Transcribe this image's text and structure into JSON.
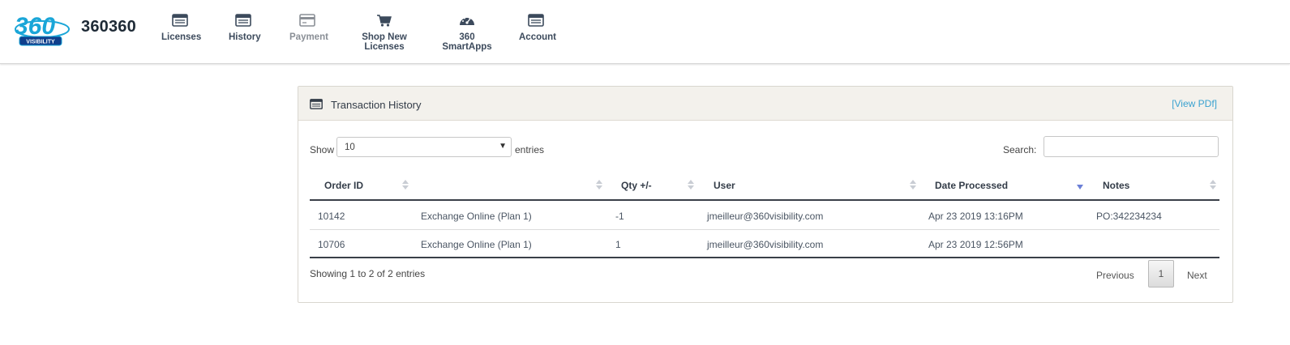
{
  "brand": {
    "logo_text": "360",
    "logo_sub": "VISIBILITY",
    "company": "360360"
  },
  "nav": [
    {
      "label": "Licenses",
      "icon": "licenses-icon",
      "enabled": true
    },
    {
      "label": "History",
      "icon": "history-icon",
      "enabled": true
    },
    {
      "label": "Payment",
      "icon": "credit-card-icon",
      "enabled": false
    },
    {
      "label": "Shop New Licenses",
      "icon": "shopping-cart-icon",
      "enabled": true
    },
    {
      "label": "360 SmartApps",
      "icon": "dashboard-gauge-icon",
      "enabled": true
    },
    {
      "label": "Account",
      "icon": "account-icon",
      "enabled": true
    }
  ],
  "panel": {
    "title": "Transaction History",
    "view_pdf": "[View PDf]",
    "show_label": "Show",
    "entries_value": "10",
    "entries_label": "entries",
    "search_label": "Search:",
    "search_value": ""
  },
  "table": {
    "columns": [
      "Order ID",
      "",
      "Qty +/-",
      "User",
      "Date Processed",
      "Notes"
    ],
    "rows": [
      [
        "10142",
        "Exchange Online (Plan 1)",
        "-1",
        "jmeilleur@360visibility.com",
        "Apr 23 2019 13:16PM",
        "PO:342234234"
      ],
      [
        "10706",
        "Exchange Online (Plan 1)",
        "1",
        "jmeilleur@360visibility.com",
        "Apr 23 2019 12:56PM",
        ""
      ]
    ]
  },
  "footer": {
    "info": "Showing 1 to 2 of 2 entries",
    "previous": "Previous",
    "page": "1",
    "next": "Next"
  },
  "colors": {
    "brand_blue": "#1aa6d8",
    "link": "#3aa2d0",
    "sort_active": "#6b7fd6"
  }
}
